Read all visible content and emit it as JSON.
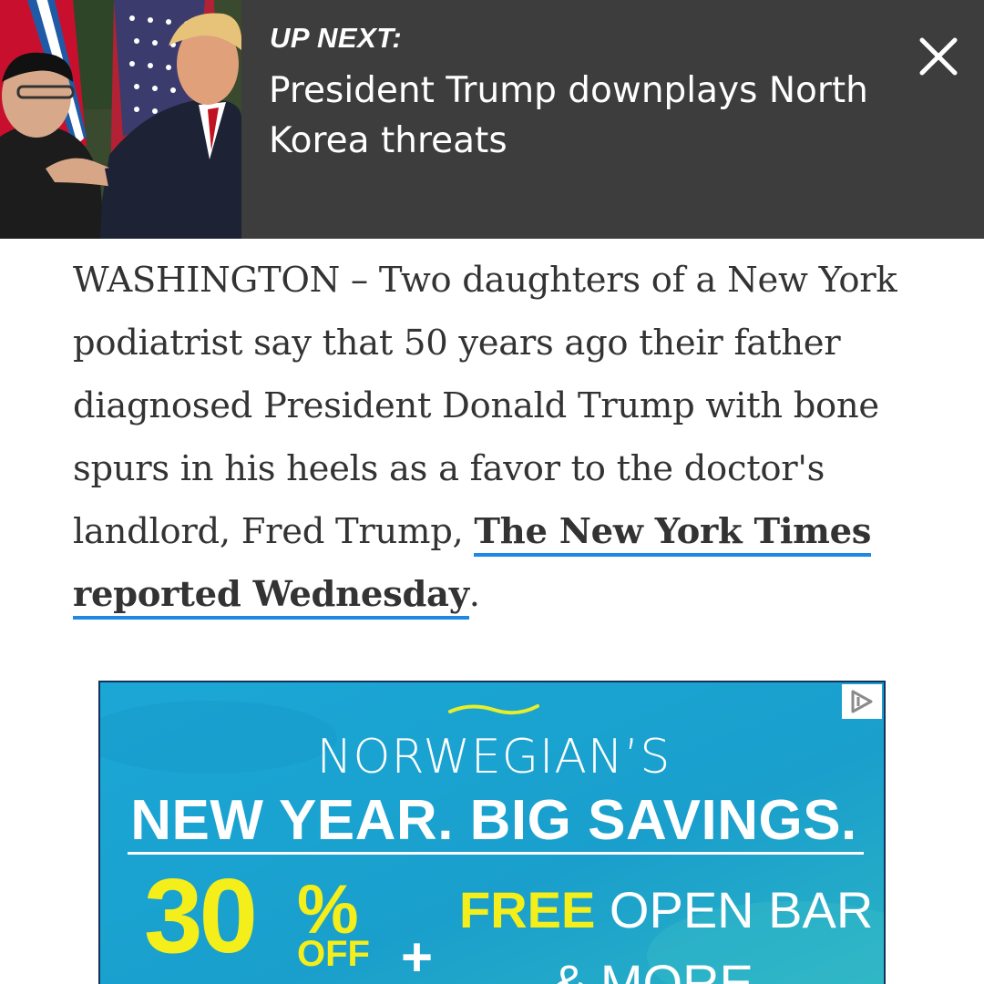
{
  "up_next": {
    "label": "UP NEXT:",
    "headline": "President Trump downplays North Korea threats",
    "background_color": "#3d3d3d",
    "close_icon": "close-icon"
  },
  "article": {
    "text_before_link": "WASHINGTON – Two daughters of a New York podiatrist say that 50 years ago their father diagnosed President Donald Trump with bone spurs in his heels as a favor to the doctor's landlord, Fred Trump, ",
    "link_text": "The New York Times reported Wednesday",
    "text_after_link": ".",
    "link_underline_color": "#1e88e5"
  },
  "ad": {
    "brand": "NORWEGIAN’S",
    "headline": "NEW YEAR. BIG SAVINGS.",
    "discount_number": "30",
    "discount_symbol": "%",
    "discount_suffix": "OFF",
    "plus": "+",
    "offer_highlight": "FREE",
    "offer_rest": " OPEN BAR",
    "offer_line2": "& MORE",
    "background_color": "#1aa3d0",
    "highlight_color": "#f4ee1a",
    "choices_icon": "ad-choices-icon"
  }
}
